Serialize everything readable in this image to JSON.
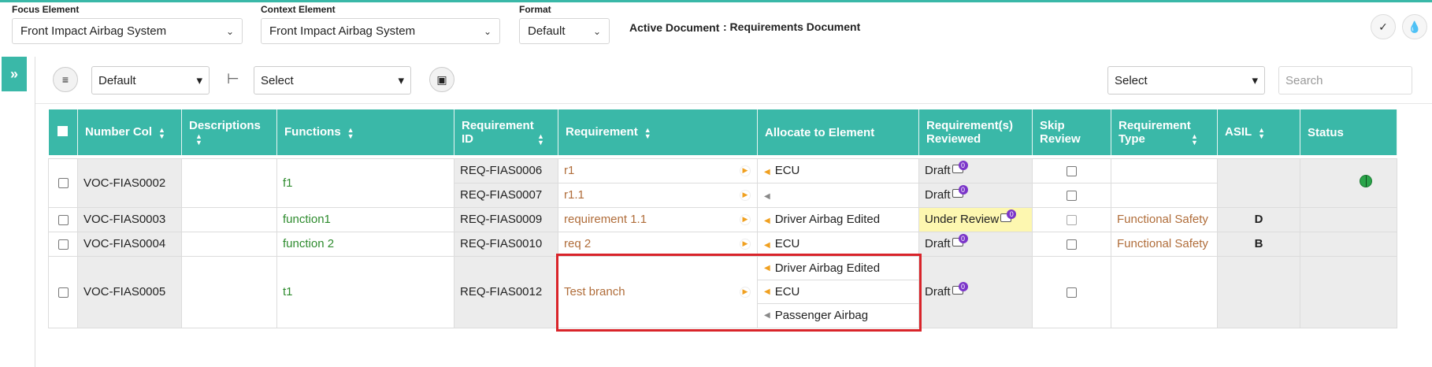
{
  "filters": {
    "focus_label": "Focus Element",
    "focus_value": "Front Impact Airbag System",
    "context_label": "Context Element",
    "context_value": "Front Impact Airbag System",
    "format_label": "Format",
    "format_value": "Default",
    "active_doc_label": "Active Document",
    "active_doc_value": ": Requirements Document"
  },
  "toolbar": {
    "view_select": "Default",
    "hierarchy_select": "Select",
    "right_select": "Select",
    "search_placeholder": "Search"
  },
  "table": {
    "headers": {
      "number_col": "Number Col",
      "descriptions": "Descriptions",
      "functions": "Functions",
      "req_id": "Requirement ID",
      "requirement": "Requirement",
      "allocate": "Allocate to Element",
      "reviewed": "Requirement(s) Reviewed",
      "skip_review": "Skip Review",
      "req_type": "Requirement Type",
      "asil": "ASIL",
      "status": "Status"
    },
    "rows": [
      {
        "number": "VOC-FIAS0002",
        "function": "f1",
        "reqs": [
          {
            "id": "REQ-FIAS0006",
            "text": "r1",
            "alloc": [
              "ECU"
            ],
            "reviewed": "Draft",
            "comments": "0"
          },
          {
            "id": "REQ-FIAS0007",
            "text": "r1.1",
            "alloc": [
              ""
            ],
            "reviewed": "Draft",
            "comments": "0"
          }
        ]
      },
      {
        "number": "VOC-FIAS0003",
        "function": "function1",
        "reqs": [
          {
            "id": "REQ-FIAS0009",
            "text": "requirement 1.1",
            "alloc": [
              "Driver Airbag Edited"
            ],
            "reviewed": "Under Review",
            "comments": "0",
            "type": "Functional Safety",
            "asil": "D"
          }
        ]
      },
      {
        "number": "VOC-FIAS0004",
        "function": "function 2",
        "reqs": [
          {
            "id": "REQ-FIAS0010",
            "text": "req 2",
            "alloc": [
              "ECU"
            ],
            "reviewed": "Draft",
            "comments": "0",
            "type": "Functional Safety",
            "asil": "B"
          }
        ]
      },
      {
        "number": "VOC-FIAS0005",
        "function": "t1",
        "reqs": [
          {
            "id": "REQ-FIAS0012",
            "text": "Test branch",
            "alloc": [
              "Driver Airbag Edited",
              "ECU",
              "Passenger Airbag"
            ],
            "reviewed": "Draft",
            "comments": "0"
          }
        ]
      }
    ]
  },
  "colors": {
    "accent": "#3ab8a8",
    "highlight": "#d9242a",
    "comment_badge": "#7b35c9"
  }
}
